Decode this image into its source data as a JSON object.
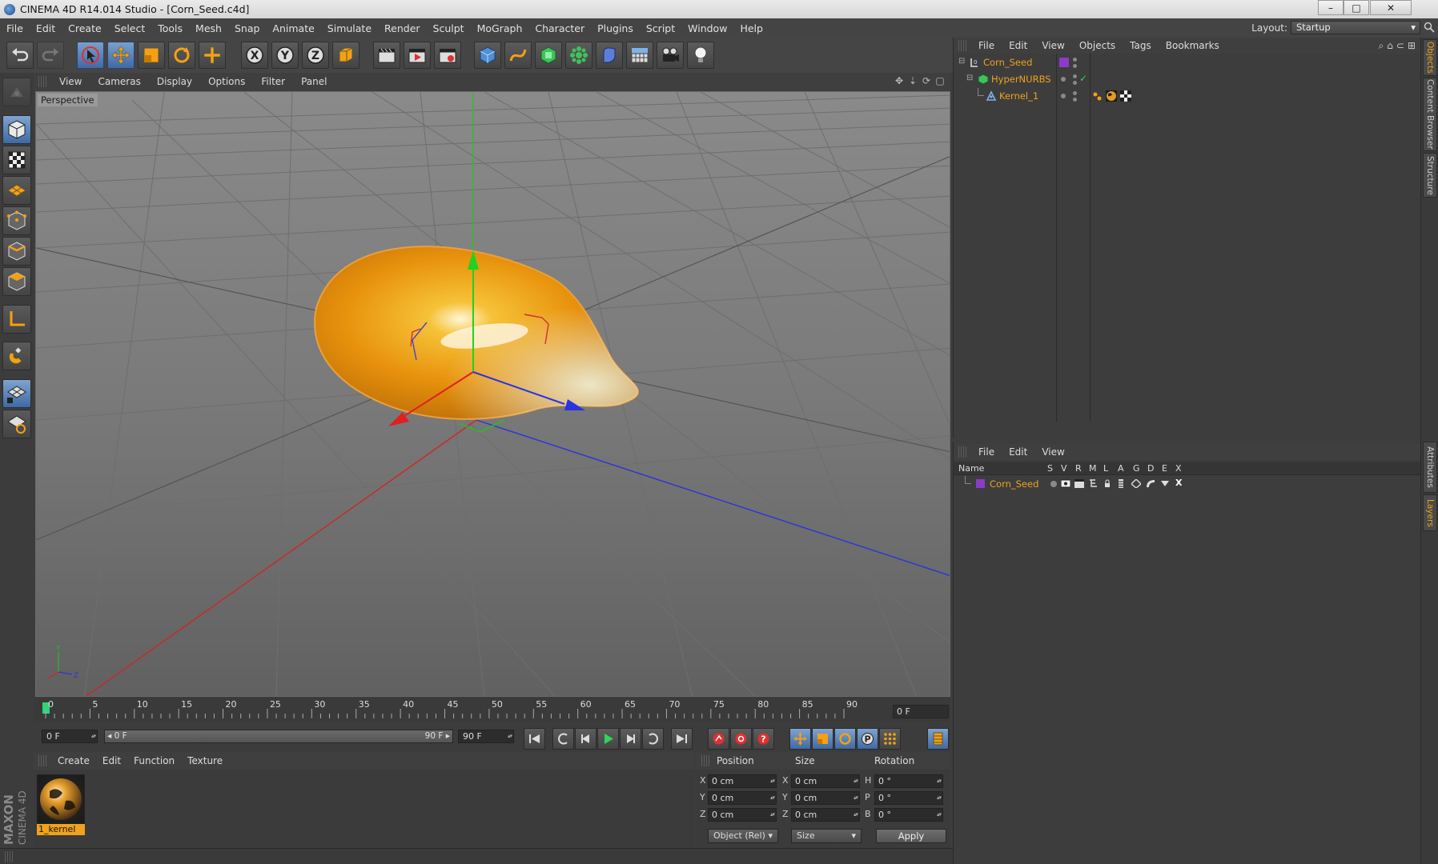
{
  "window": {
    "title": "CINEMA 4D R14.014 Studio - [Corn_Seed.c4d]",
    "minimize": "–",
    "maximize": "□",
    "close": "✕"
  },
  "menubar": {
    "items": [
      "File",
      "Edit",
      "Create",
      "Select",
      "Tools",
      "Mesh",
      "Snap",
      "Animate",
      "Simulate",
      "Render",
      "Sculpt",
      "MoGraph",
      "Character",
      "Plugins",
      "Script",
      "Window",
      "Help"
    ]
  },
  "layout": {
    "label": "Layout:",
    "value": "Startup"
  },
  "viewport": {
    "menu": [
      "View",
      "Cameras",
      "Display",
      "Options",
      "Filter",
      "Panel"
    ],
    "camera_label": "Perspective"
  },
  "timeline": {
    "ticks": [
      "0",
      "5",
      "10",
      "15",
      "20",
      "25",
      "30",
      "35",
      "40",
      "45",
      "50",
      "55",
      "60",
      "65",
      "70",
      "75",
      "80",
      "85",
      "90"
    ],
    "current_frame": "0 F"
  },
  "playback": {
    "start_field": "0 F",
    "range_start": "◂ 0 F",
    "range_end": "90 F ▸",
    "end_field": "90 F"
  },
  "material_manager": {
    "menu": [
      "Create",
      "Edit",
      "Function",
      "Texture"
    ],
    "materials": [
      {
        "name": "1_kernel"
      }
    ]
  },
  "coordinates": {
    "headers": {
      "position": "Position",
      "size": "Size",
      "rotation": "Rotation"
    },
    "rows": [
      {
        "axis": "X",
        "pos": "0 cm",
        "size_axis": "X",
        "size": "0 cm",
        "rot_axis": "H",
        "rot": "0 °"
      },
      {
        "axis": "Y",
        "pos": "0 cm",
        "size_axis": "Y",
        "size": "0 cm",
        "rot_axis": "P",
        "rot": "0 °"
      },
      {
        "axis": "Z",
        "pos": "0 cm",
        "size_axis": "Z",
        "size": "0 cm",
        "rot_axis": "B",
        "rot": "0 °"
      }
    ],
    "mode": "Object (Rel)",
    "size_mode": "Size",
    "apply": "Apply"
  },
  "object_manager": {
    "menu": [
      "File",
      "Edit",
      "View",
      "Objects",
      "Tags",
      "Bookmarks"
    ],
    "objects": [
      {
        "name": "Corn_Seed"
      },
      {
        "name": "HyperNURBS"
      },
      {
        "name": "Kernel_1"
      }
    ]
  },
  "layer_manager": {
    "menu": [
      "File",
      "Edit",
      "View"
    ],
    "columns": [
      "Name",
      "S",
      "V",
      "R",
      "M",
      "L",
      "A",
      "G",
      "D",
      "E",
      "X"
    ],
    "layers": [
      {
        "name": "Corn_Seed",
        "color": "#8a3cc8"
      }
    ]
  },
  "right_tabs": [
    "Objects",
    "Content Browser",
    "Structure",
    "Attributes",
    "Layers"
  ],
  "colors": {
    "accent": "#f0a21c",
    "selection": "#4a76b0",
    "x_axis": "#d22020",
    "y_axis": "#20c020",
    "z_axis": "#2030e0"
  }
}
